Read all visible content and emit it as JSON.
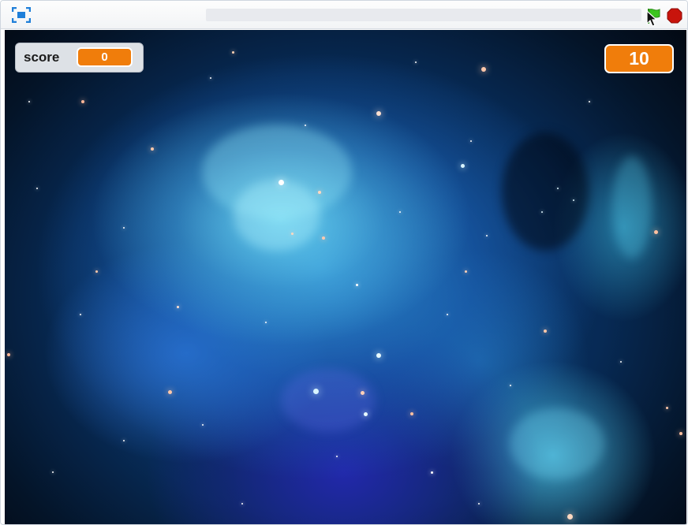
{
  "colors": {
    "monitor_orange": "#f07d0b",
    "monitor_bg": "#dde1e6",
    "green_flag": "#3cc41e",
    "stop_red": "#c8140c",
    "nebula_cyan": "#6ed9f5",
    "space_dark": "#02070f"
  },
  "controls": {
    "fullscreen_icon": "fullscreen-icon",
    "green_flag_icon": "green-flag-icon",
    "stop_icon": "stop-sign-icon",
    "cursor_icon": "mouse-pointer-icon"
  },
  "stage": {
    "backdrop": "space nebula",
    "score_monitor": {
      "label": "score",
      "value": "0"
    },
    "timer_display": {
      "value": "10"
    }
  }
}
